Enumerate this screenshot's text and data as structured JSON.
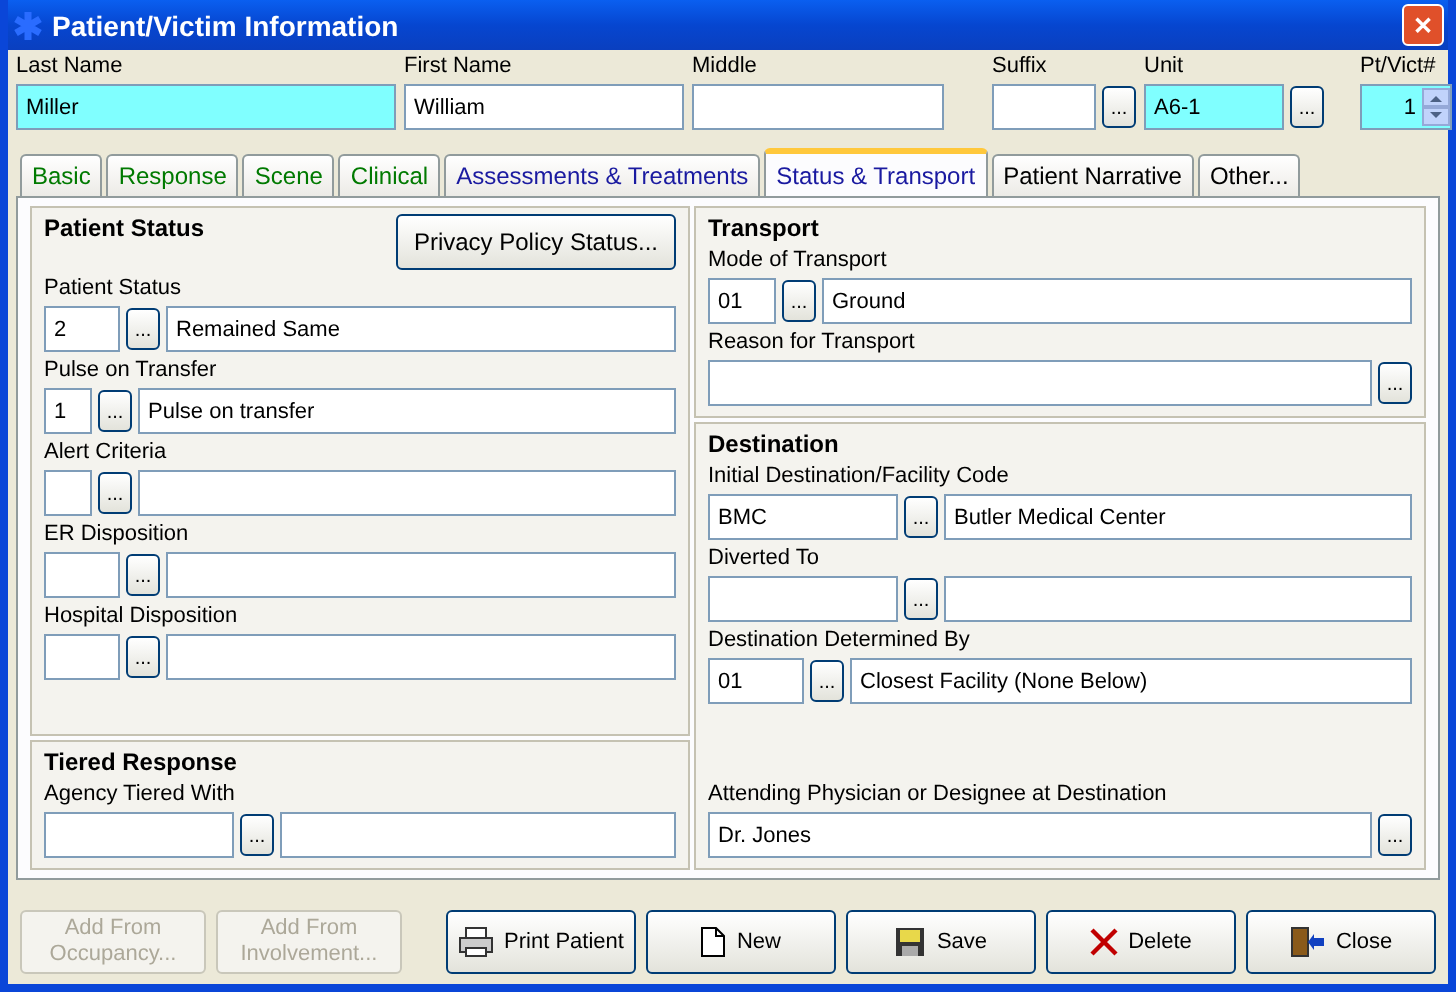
{
  "window": {
    "title": "Patient/Victim Information",
    "close": "✕"
  },
  "header_fields": [
    {
      "label": "Last Name",
      "value": "Miller",
      "highlighted": true,
      "lookup": false,
      "kind": "text"
    },
    {
      "label": "First Name",
      "value": "William",
      "highlighted": false,
      "lookup": false,
      "kind": "text"
    },
    {
      "label": "Middle",
      "highlighted": false,
      "lookup": false,
      "kind": "text"
    },
    {
      "label": "Suffix",
      "highlighted": false,
      "lookup": true,
      "kind": "text"
    },
    {
      "label": "Unit",
      "value": "A6-1",
      "highlighted": true,
      "lookup": true,
      "kind": "text"
    },
    {
      "label": "Pt/Vict#",
      "value": "1",
      "highlighted": true,
      "lookup": false,
      "kind": "spin"
    }
  ],
  "lookup_label": "...",
  "tabs": [
    {
      "label": "Basic",
      "selected": false,
      "color": "#007a00"
    },
    {
      "label": "Response",
      "selected": false,
      "color": "#007a00"
    },
    {
      "label": "Scene",
      "selected": false,
      "color": "#007a00"
    },
    {
      "label": "Clinical",
      "selected": false,
      "color": "#007a00"
    },
    {
      "label": "Assessments & Treatments",
      "selected": false,
      "color": "#1a1aa0"
    },
    {
      "label": "Status & Transport",
      "selected": true,
      "color": "#1a1aa0"
    },
    {
      "label": "Patient Narrative",
      "selected": false,
      "color": "#000000"
    },
    {
      "label": "Other...",
      "selected": false,
      "color": "#000000"
    }
  ],
  "left_sections": [
    {
      "title": "Patient Status",
      "button": "Privacy Policy Status...",
      "fields": [
        {
          "kind": "code",
          "label": "Patient Status",
          "code": "2",
          "description": "Remained Same"
        },
        {
          "kind": "code",
          "label": "Pulse on Transfer",
          "code": "1",
          "description": "Pulse on transfer"
        },
        {
          "kind": "code",
          "label": "Alert Criteria"
        },
        {
          "kind": "code",
          "label": "ER Disposition"
        },
        {
          "kind": "code",
          "label": "Hospital Disposition"
        }
      ]
    },
    {
      "title": "Tiered Response",
      "fields": [
        {
          "kind": "code",
          "label": "Agency Tiered With"
        }
      ]
    }
  ],
  "right_sections": [
    {
      "title": "Transport",
      "fields": [
        {
          "kind": "code",
          "label": "Mode of Transport",
          "code": "01",
          "description": "Ground"
        },
        {
          "kind": "text",
          "label": "Reason for Transport"
        }
      ]
    },
    {
      "title": "Destination",
      "fields": [
        {
          "kind": "code",
          "label": "Initial Destination/Facility Code",
          "code": "BMC",
          "description": "Butler Medical Center"
        },
        {
          "kind": "code",
          "label": "Diverted To"
        },
        {
          "kind": "code",
          "label": "Destination Determined By",
          "code": "01",
          "description": "Closest Facility (None Below)"
        },
        {
          "kind": "gap"
        },
        {
          "kind": "text",
          "label": "Attending Physician or Designee at Destination",
          "value": "Dr. Jones"
        }
      ]
    }
  ],
  "footer_buttons": [
    {
      "label": "Add From Occupancy...",
      "kind": "plain",
      "disabled": true
    },
    {
      "label": "Add From Involvement...",
      "kind": "plain",
      "disabled": true
    },
    {
      "label": "Print Patient",
      "kind": "print",
      "disabled": false
    },
    {
      "label": "New",
      "kind": "new",
      "disabled": false
    },
    {
      "label": "Save",
      "kind": "save",
      "disabled": false
    },
    {
      "label": "Delete",
      "kind": "delete",
      "disabled": false
    },
    {
      "label": "Close",
      "kind": "close",
      "disabled": false
    }
  ]
}
